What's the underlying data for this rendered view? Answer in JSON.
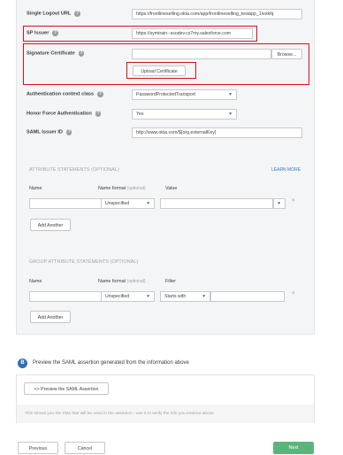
{
  "form": {
    "single_logout_url": {
      "label": "Single Logout URL",
      "value": "https://frontlineselling.okta.com/app/frontlineselling_testapp_1/exkfq"
    },
    "sp_issuer": {
      "label": "SP Issuer",
      "value": "https://symtrain--ssodev.cs7my.salesforce.com"
    },
    "signature_certificate": {
      "label": "Signature Certificate",
      "browse_label": "Browse...",
      "upload_label": "Upload Certificate"
    },
    "authn_context": {
      "label": "Authentication context class",
      "value": "PasswordProtectedTransport"
    },
    "honor_force": {
      "label": "Honor Force Authentication",
      "value": "Yes"
    },
    "saml_issuer": {
      "label": "SAML Issuer ID",
      "value": "http://www.okta.com/${org.externalKey}"
    }
  },
  "attribute_statements": {
    "title": "ATTRIBUTE STATEMENTS (OPTIONAL)",
    "learn_more": "LEARN MORE",
    "col_name": "Name",
    "col_format": "Name format",
    "col_optional": "(optional)",
    "col_value": "Value",
    "format_value": "Unspecified",
    "add_another": "Add Another",
    "remove": "×"
  },
  "group_attribute_statements": {
    "title": "GROUP ATTRIBUTE STATEMENTS (OPTIONAL)",
    "col_name": "Name",
    "col_format": "Name format",
    "col_optional": "(optional)",
    "col_filter": "Filter",
    "format_value": "Unspecified",
    "filter_value": "Starts with",
    "add_another": "Add Another",
    "remove": "×"
  },
  "preview": {
    "step": "B",
    "heading": "Preview the SAML assertion generated from the information above",
    "button_icon": "<>",
    "button_label": "Preview the SAML Assertion",
    "info": "This shows you the XML that will be used in the assertion - use it to verify the info you entered above"
  },
  "footer": {
    "previous": "Previous",
    "cancel": "Cancel",
    "next": "Next"
  },
  "colors": {
    "highlight": "#d0141c",
    "primary": "#5bb57b",
    "link": "#2f78c4"
  }
}
